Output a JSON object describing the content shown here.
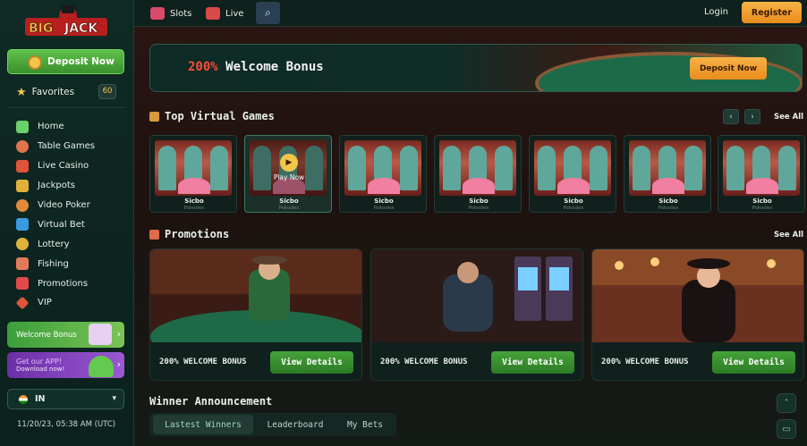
{
  "brand": {
    "logo_text": "BIG JACK"
  },
  "sidebar": {
    "deposit_label": "Deposit Now",
    "favorites_label": "Favorites",
    "favorites_count": "60",
    "items": [
      {
        "label": "Home",
        "icon": "home-icon",
        "color": "#6bd16a"
      },
      {
        "label": "Table Games",
        "icon": "poker-table-icon",
        "color": "#e0744a"
      },
      {
        "label": "Live Casino",
        "icon": "live-casino-icon",
        "color": "#e0543a"
      },
      {
        "label": "Jackpots",
        "icon": "trophy-icon",
        "color": "#e0b23a"
      },
      {
        "label": "Video Poker",
        "icon": "video-poker-icon",
        "color": "#e08a3a"
      },
      {
        "label": "Virtual Bet",
        "icon": "virtual-bet-icon",
        "color": "#3a9ae0"
      },
      {
        "label": "Lottery",
        "icon": "lottery-icon",
        "color": "#e0b23a"
      },
      {
        "label": "Fishing",
        "icon": "fish-icon",
        "color": "#e07a5a"
      },
      {
        "label": "Promotions",
        "icon": "gift-icon",
        "color": "#e04a4a"
      },
      {
        "label": "VIP",
        "icon": "diamond-icon",
        "color": "#e0543a"
      }
    ],
    "welcome_card": "Welcome Bonus",
    "app_card": {
      "line1": "Get our APP!",
      "line2": "Download now!"
    },
    "language": "IN",
    "timestamp": "11/20/23, 05:38 AM (UTC)"
  },
  "topbar": {
    "slots": "Slots",
    "live": "Live",
    "login": "Login",
    "register": "Register"
  },
  "banner": {
    "percent": "200%",
    "title": " Welcome Bonus",
    "button": "Deposit Now"
  },
  "virtual_games": {
    "title": "Top Virtual Games",
    "see_all": "See All",
    "play_now": "Play Now",
    "cards": [
      {
        "name": "Sicbo",
        "provider": "Pokodex"
      },
      {
        "name": "Sicbo",
        "provider": "Pokodex"
      },
      {
        "name": "Sicbo",
        "provider": "Pokodex"
      },
      {
        "name": "Sicbo",
        "provider": "Pokodex"
      },
      {
        "name": "Sicbo",
        "provider": "Pokodex"
      },
      {
        "name": "Sicbo",
        "provider": "Pokodex"
      },
      {
        "name": "Sicbo",
        "provider": "Pokodex"
      }
    ]
  },
  "promotions": {
    "title": "Promotions",
    "see_all": "See All",
    "cards": [
      {
        "caption": "200% WELCOME BONUS",
        "button": "View Details"
      },
      {
        "caption": "200% WELCOME BONUS",
        "button": "View Details"
      },
      {
        "caption": "200% WELCOME BONUS",
        "button": "View Details"
      }
    ]
  },
  "winners": {
    "title": "Winner Announcement",
    "tabs": [
      "Lastest Winners",
      "Leaderboard",
      "My Bets"
    ]
  },
  "colors": {
    "accent_orange": "#f8b346",
    "accent_green": "#46a33a",
    "sidebar_bg": "#0f2a24"
  }
}
